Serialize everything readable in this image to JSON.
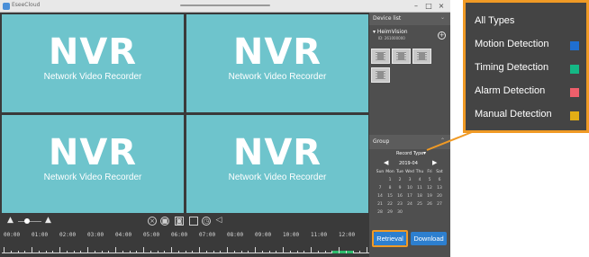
{
  "titlebar": {
    "title": "EseeCloud",
    "minimize": "–",
    "maximize": "□",
    "close": "×"
  },
  "tiles": [
    {
      "big": "NVR",
      "small": "Network Video Recorder"
    },
    {
      "big": "NVR",
      "small": "Network Video Recorder"
    },
    {
      "big": "NVR",
      "small": "Network Video Recorder"
    },
    {
      "big": "NVR",
      "small": "Network Video Recorder"
    }
  ],
  "controls": {
    "icons": [
      "mountain-small-icon",
      "mountain-large-icon",
      "snapshot-icon",
      "record-icon",
      "photo-icon",
      "square-icon",
      "clock-icon",
      "volume-icon"
    ],
    "timeline_labels": [
      "00:00",
      "01:00",
      "02:00",
      "03:00",
      "04:00",
      "05:00",
      "06:00",
      "07:00",
      "08:00",
      "09:00",
      "10:00",
      "11:00",
      "12:00"
    ]
  },
  "sidebar": {
    "device_list_title": "Device list",
    "device_name": "HeimVision",
    "device_id": "ID: 261000000",
    "cameras": 4,
    "group_title": "Group",
    "record_type": "Record Type",
    "calendar": {
      "month": "2019-04",
      "prev": "◀",
      "next": "▶",
      "weekdays": [
        "Sun",
        "Mon",
        "Tue",
        "Wed",
        "Thu",
        "Fri",
        "Sat"
      ],
      "days": [
        "",
        "1",
        "2",
        "3",
        "4",
        "5",
        "6",
        "7",
        "8",
        "9",
        "10",
        "11",
        "12",
        "13",
        "14",
        "15",
        "16",
        "17",
        "18",
        "19",
        "20",
        "21",
        "22",
        "23",
        "24",
        "25",
        "26",
        "27",
        "28",
        "29",
        "30"
      ]
    },
    "retrieval_label": "Retrieval",
    "download_label": "Download"
  },
  "legend": {
    "items": [
      {
        "label": "All Types",
        "color": ""
      },
      {
        "label": "Motion Detection",
        "color": "#1f6fd1"
      },
      {
        "label": "Timing Detection",
        "color": "#14b885"
      },
      {
        "label": "Alarm Detection",
        "color": "#ee5f6b"
      },
      {
        "label": "Manual Detection",
        "color": "#e2ad15"
      }
    ]
  },
  "colors": {
    "highlight": "#f09a25",
    "tile": "#6ec4cc",
    "button": "#2d7fcf",
    "record_bar": "#2dba6b"
  }
}
